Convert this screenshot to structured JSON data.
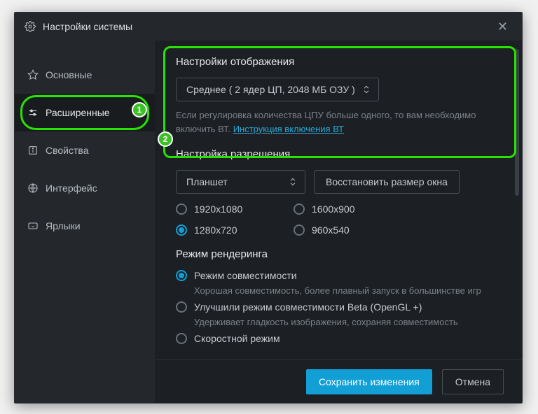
{
  "title": "Настройки системы",
  "sidebar": {
    "items": [
      {
        "label": "Основные"
      },
      {
        "label": "Расширенные"
      },
      {
        "label": "Свойства"
      },
      {
        "label": "Интерфейс"
      },
      {
        "label": "Ярлыки"
      }
    ]
  },
  "badges": {
    "b1": "1",
    "b2": "2"
  },
  "display": {
    "title": "Настройки отображения",
    "select_value": "Среднее ( 2 ядер ЦП, 2048 МБ ОЗУ )",
    "hint_before": "Если регулировка количества ЦПУ больше одного, то вам необходимо включить ВТ. ",
    "hint_link": "Инструкция включения ВТ"
  },
  "resolution": {
    "title": "Настройка разрешения",
    "mode": "Планшет",
    "restore": "Восстановить размер окна",
    "options": [
      "1920x1080",
      "1600x900",
      "1280x720",
      "960x540"
    ],
    "selected": "1280x720"
  },
  "render": {
    "title": "Режим рендеринга",
    "opt1": "Режим совместимости",
    "desc1": "Хорошая совместимость, более плавный запуск в большинстве игр",
    "opt2": "Улучшили режим совместимости Beta (OpenGL +)",
    "desc2": "Удерживает гладкость изображения, сохраняя совместимость",
    "opt3": "Скоростной режим"
  },
  "footer": {
    "save": "Сохранить изменения",
    "cancel": "Отмена"
  }
}
